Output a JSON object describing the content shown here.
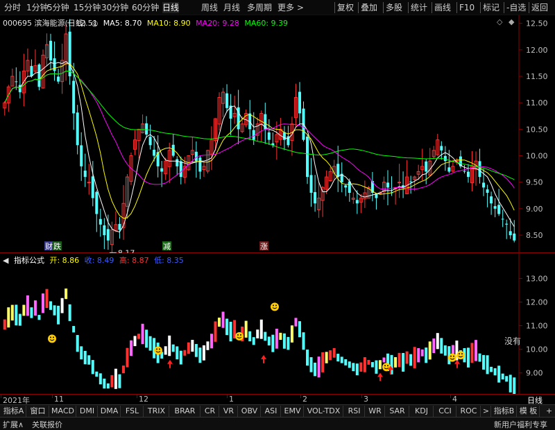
{
  "topbar": {
    "left_items": [
      "分时",
      "1分钟",
      "5分钟",
      "15分钟",
      "30分钟",
      "60分钟",
      "日线",
      "周线",
      "月线",
      "多周期",
      "更多 >"
    ],
    "active": "日线",
    "right_items": [
      "复权",
      "叠加",
      "多股",
      "统计",
      "画线",
      "F10",
      "标记",
      "-自选",
      "返回"
    ]
  },
  "main": {
    "stock": "000695 滨海能源(日线)",
    "ma5": "MA5: 8.70",
    "ma10": "MA10: 8.90",
    "ma20": "MA20: 9.28",
    "ma60": "MA60: 9.39",
    "high_label": "12.51",
    "low_label": "8.17",
    "y_ticks": [
      "12.50",
      "12.00",
      "11.50",
      "11.00",
      "10.50",
      "10.00",
      "9.50",
      "9.00",
      "8.50"
    ],
    "markers": {
      "die": "跌",
      "jian": "减",
      "zhang": "涨",
      "cai": "财"
    }
  },
  "indicator": {
    "name": "指标公式",
    "open": "开: 8.86",
    "close": "收: 8.49",
    "high": "高: 8.87",
    "low": "低: 8.35",
    "y_ticks": [
      "13.00",
      "12.00",
      "11.00",
      "10.00",
      "9.00"
    ],
    "side_text": "没有"
  },
  "axis": {
    "dates": [
      "2021年",
      "11",
      "12",
      "1",
      "2",
      "3",
      "4"
    ],
    "period": "日线"
  },
  "tabs": [
    "指标A",
    "窗口",
    "MACD",
    "DMI",
    "DMA",
    "FSL",
    "TRIX",
    "BRAR",
    "CR",
    "VR",
    "OBV",
    "ASI",
    "EMV",
    "VOL-TDX",
    "RSI",
    "WR",
    "SAR",
    "KDJ",
    "CCI",
    "ROC",
    ">",
    "指标B",
    "模 板",
    "+",
    "-"
  ],
  "status": {
    "left1": "扩展∧",
    "left2": "关联报价",
    "right": "新用户福利专享"
  },
  "colors": {
    "up": "#ff3232",
    "down": "#54ffff",
    "ma5": "#ffffff",
    "ma10": "#ffff00",
    "ma20": "#ff00ff",
    "ma60": "#00ff00"
  },
  "chart_data": {
    "type": "candlestick",
    "title": "000695 滨海能源(日线)",
    "ylim": [
      8.2,
      12.6
    ],
    "x_labels": [
      "2021年",
      "11",
      "12",
      "1",
      "2",
      "3",
      "4"
    ],
    "highest": 12.51,
    "lowest": 8.17,
    "close_series": [
      11.0,
      11.3,
      11.5,
      11.4,
      11.2,
      11.6,
      11.8,
      11.5,
      11.7,
      11.3,
      11.9,
      12.1,
      11.8,
      11.6,
      11.4,
      11.8,
      12.3,
      11.5,
      10.8,
      10.2,
      9.8,
      9.6,
      9.5,
      9.2,
      8.9,
      8.7,
      8.5,
      8.4,
      8.6,
      8.7,
      8.6,
      9.1,
      9.6,
      10.0,
      10.3,
      10.5,
      10.6,
      10.4,
      10.2,
      10.0,
      9.8,
      9.7,
      9.9,
      10.1,
      10.0,
      9.8,
      9.6,
      9.8,
      10.0,
      10.1,
      9.9,
      9.7,
      9.8,
      10.1,
      10.3,
      10.7,
      11.1,
      11.2,
      10.9,
      10.7,
      10.8,
      10.5,
      10.6,
      10.8,
      10.5,
      10.3,
      10.6,
      10.8,
      10.5,
      10.3,
      10.2,
      10.4,
      10.5,
      10.3,
      10.2,
      10.6,
      11.1,
      10.8,
      10.3,
      9.6,
      9.3,
      9.1,
      9.2,
      9.4,
      9.6,
      9.7,
      9.8,
      9.6,
      9.5,
      9.4,
      9.3,
      9.2,
      9.1,
      9.2,
      9.3,
      9.4,
      9.3,
      9.2,
      9.3,
      9.5,
      9.4,
      9.3,
      9.4,
      9.5,
      9.4,
      9.6,
      9.5,
      9.6,
      9.7,
      9.8,
      9.7,
      9.9,
      10.1,
      10.3,
      10.1,
      9.9,
      9.7,
      9.8,
      9.9,
      9.8,
      9.7,
      9.6,
      9.8,
      9.9,
      9.6,
      9.4,
      9.3,
      9.1,
      9.0,
      8.9,
      8.8,
      8.7,
      8.5,
      8.4
    ],
    "indicator_ylim": [
      8.2,
      13.6
    ]
  }
}
